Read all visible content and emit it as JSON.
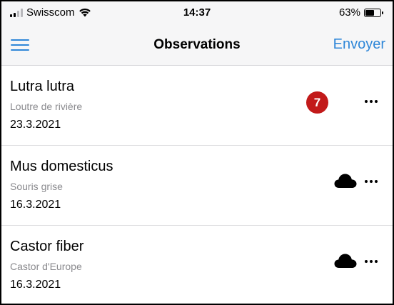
{
  "status_bar": {
    "carrier": "Swisscom",
    "time": "14:37",
    "battery_percent": "63%",
    "battery_level": 0.63
  },
  "nav": {
    "title": "Observations",
    "send_label": "Envoyer",
    "menu_icon": "hamburger-menu-icon",
    "accent_color": "#2f87d8"
  },
  "observations": [
    {
      "scientific_name": "Lutra lutra",
      "common_name": "Loutre de rivière",
      "date": "23.3.2021",
      "status": "badge",
      "badge_count": "7",
      "badge_color": "#c21a1a"
    },
    {
      "scientific_name": "Mus domesticus",
      "common_name": "Souris grise",
      "date": "16.3.2021",
      "status": "cloud",
      "status_icon": "cloud-icon"
    },
    {
      "scientific_name": "Castor fiber",
      "common_name": "Castor d'Europe",
      "date": "16.3.2021",
      "status": "cloud",
      "status_icon": "cloud-icon"
    }
  ]
}
